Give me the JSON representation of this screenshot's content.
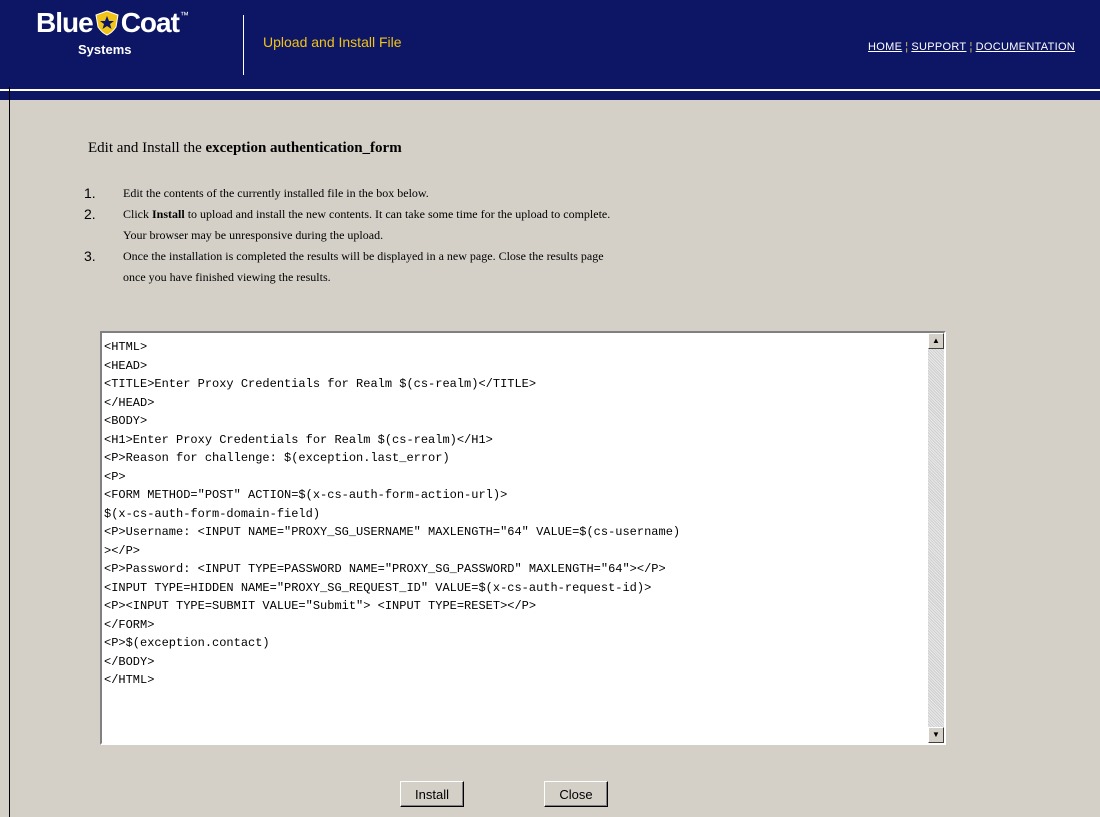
{
  "brand": {
    "name_left": "Blue",
    "name_right": "Coat",
    "trademark": "™",
    "sub": "Systems",
    "colors": {
      "header_bg": "#0d1565",
      "title": "#f0c418",
      "badge": "#f0c418"
    }
  },
  "header": {
    "title": "Upload and Install File",
    "nav": [
      "HOME",
      "SUPPORT",
      "DOCUMENTATION"
    ],
    "nav_separator": "¦"
  },
  "main": {
    "heading_prefix": "Edit and Install the",
    "heading_bold": "exception authentication_form",
    "steps": [
      {
        "num": "1.",
        "lines": [
          "Edit the contents of the currently installed file in the box below."
        ]
      },
      {
        "num": "2.",
        "prefix": "Click ",
        "bold": "Install",
        "rest": " to upload and install the new contents. It can take some time for the upload to complete.",
        "line2": "Your browser may be unresponsive during the upload."
      },
      {
        "num": "3.",
        "lines": [
          "Once the installation is completed the results will be displayed in a new page. Close the results page",
          "once you have finished viewing the results."
        ]
      }
    ],
    "editor_content": "<HTML>\n<HEAD>\n<TITLE>Enter Proxy Credentials for Realm $(cs-realm)</TITLE>\n</HEAD>\n<BODY>\n<H1>Enter Proxy Credentials for Realm $(cs-realm)</H1>\n<P>Reason for challenge: $(exception.last_error)\n<P>\n<FORM METHOD=\"POST\" ACTION=$(x-cs-auth-form-action-url)>\n$(x-cs-auth-form-domain-field)\n<P>Username: <INPUT NAME=\"PROXY_SG_USERNAME\" MAXLENGTH=\"64\" VALUE=$(cs-username)\n></P>\n<P>Password: <INPUT TYPE=PASSWORD NAME=\"PROXY_SG_PASSWORD\" MAXLENGTH=\"64\"></P>\n<INPUT TYPE=HIDDEN NAME=\"PROXY_SG_REQUEST_ID\" VALUE=$(x-cs-auth-request-id)>\n<P><INPUT TYPE=SUBMIT VALUE=\"Submit\"> <INPUT TYPE=RESET></P>\n</FORM>\n<P>$(exception.contact)\n</BODY>\n</HTML>"
  },
  "buttons": {
    "install": "Install",
    "close": "Close"
  }
}
